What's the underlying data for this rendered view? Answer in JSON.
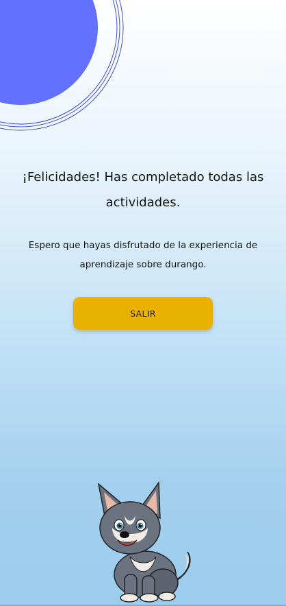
{
  "screen": {
    "title": "¡Felicidades! Has completado todas las actividades.",
    "message": "Espero que hayas disfrutado de la experiencia de aprendizaje sobre durango.",
    "exit_button_label": "SALIR"
  },
  "decoration": {
    "circle_color": "#6470ff",
    "ring_color": "#3d48d8"
  },
  "mascot": {
    "icon": "wolf-pup-mascot-icon"
  },
  "colors": {
    "button": "#e9b200",
    "background_top": "#ffffff",
    "background_bottom": "#9ccdee"
  }
}
